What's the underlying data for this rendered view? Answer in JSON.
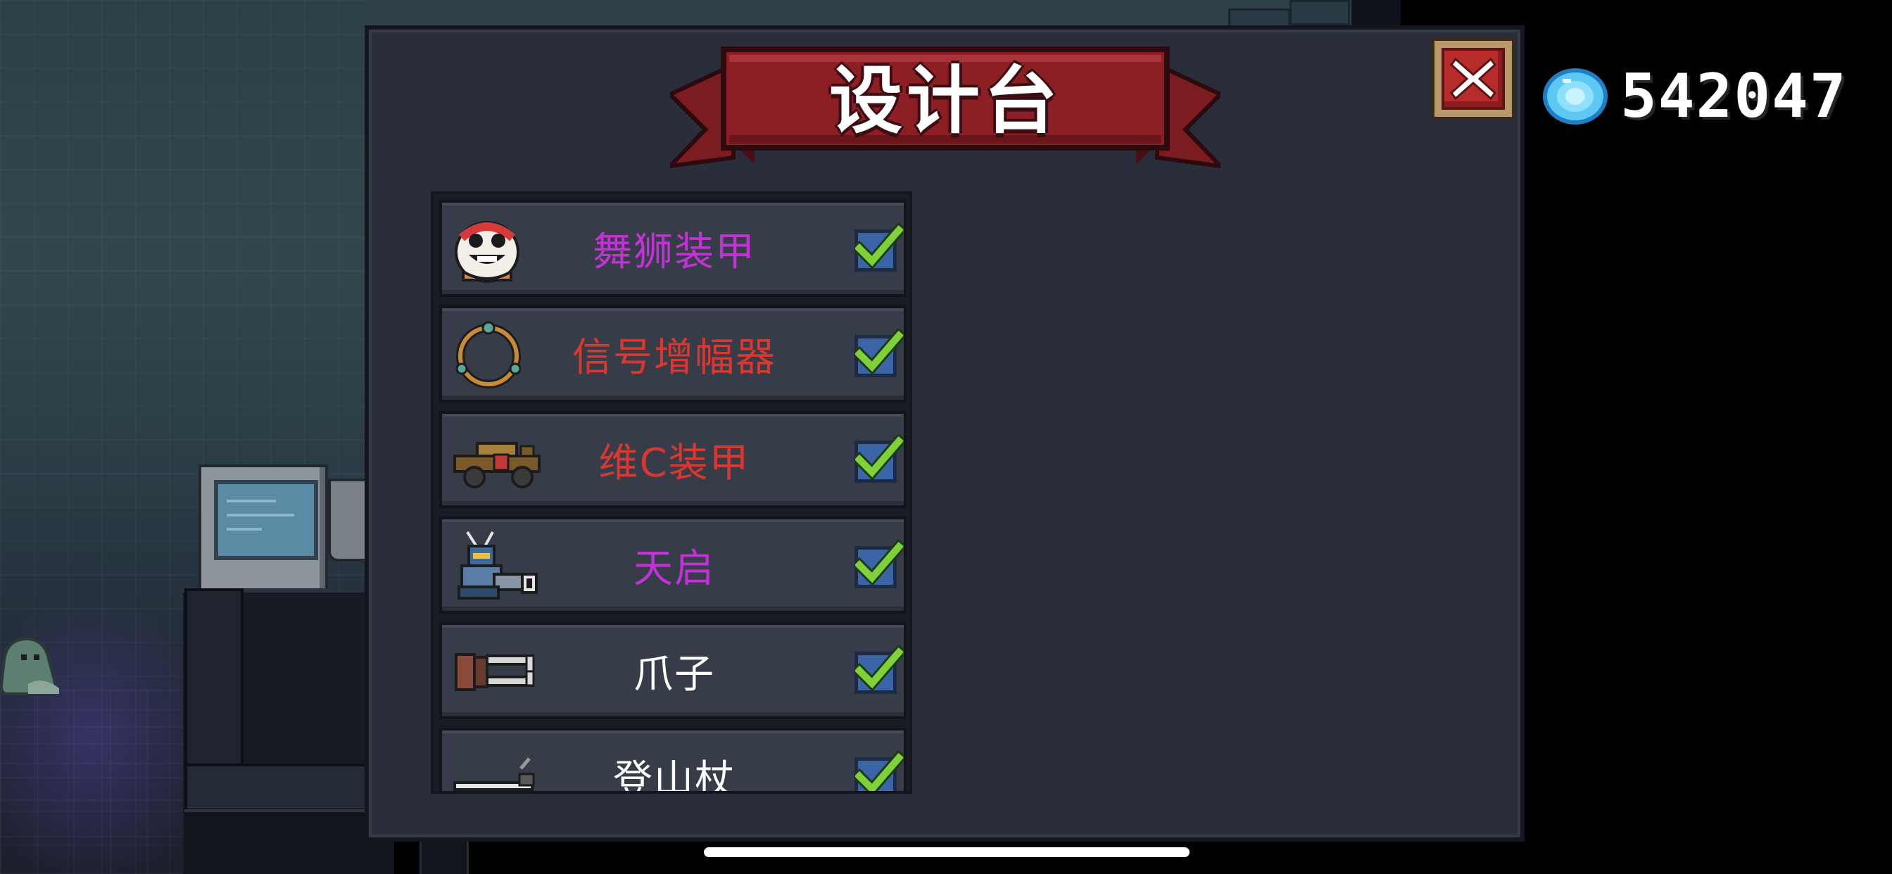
{
  "title": "设计台",
  "currency": {
    "icon": "gem-icon",
    "amount": "542047"
  },
  "close_button": {
    "icon": "close-icon"
  },
  "items": [
    {
      "name": "舞狮装甲",
      "color": "#c133d4",
      "icon": "lion-dance-mask-icon",
      "checked": true
    },
    {
      "name": "信号增幅器",
      "color": "#d8382f",
      "icon": "ring-amplifier-icon",
      "checked": true
    },
    {
      "name": "维C装甲",
      "color": "#d8382f",
      "icon": "vitamin-c-cannon-icon",
      "checked": true
    },
    {
      "name": "天启",
      "color": "#c133d4",
      "icon": "apocalypse-mech-icon",
      "checked": true
    },
    {
      "name": "爪子",
      "color": "#ffffff",
      "icon": "claw-icon",
      "checked": true
    },
    {
      "name": "登山杖",
      "color": "#ffffff",
      "icon": "hiking-pole-icon",
      "checked": true
    }
  ],
  "colors": {
    "banner": "#8c1f24",
    "panel": "#2a2e3a",
    "row": "#373c49",
    "check": "#7fd13b",
    "checkbox": "#3a66a8"
  }
}
